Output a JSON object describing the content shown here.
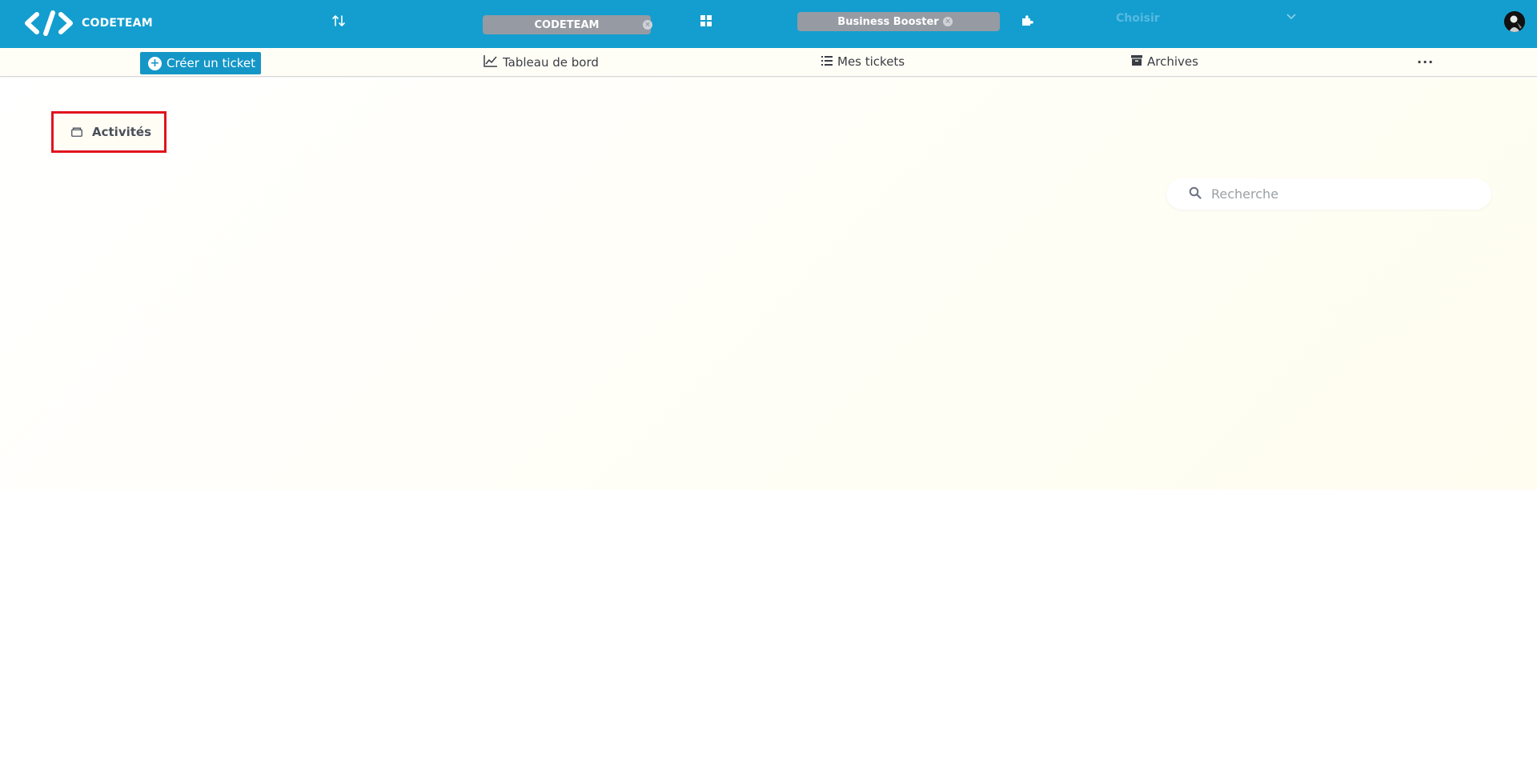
{
  "header": {
    "brand_name": "CODETEAM",
    "sort_icon": "sort-arrows-icon",
    "workspace_pill": {
      "label": "CODETEAM"
    },
    "grid_icon": "grid-icon",
    "project_pill": {
      "label": "Business Booster"
    },
    "plugin_icon": "puzzle-icon",
    "select": {
      "label": "Choisir"
    }
  },
  "subnav": {
    "create_ticket": "Créer un ticket",
    "dashboard": "Tableau de bord",
    "my_tickets": "Mes tickets",
    "archives": "Archives",
    "more": "···"
  },
  "main": {
    "activities_tab": "Activités",
    "search": {
      "placeholder": "Recherche"
    }
  },
  "colors": {
    "header_bg": "#139ecf",
    "button_bg": "#1496c7",
    "pill_bg": "#959aa3",
    "highlight_border": "#e0141e"
  }
}
